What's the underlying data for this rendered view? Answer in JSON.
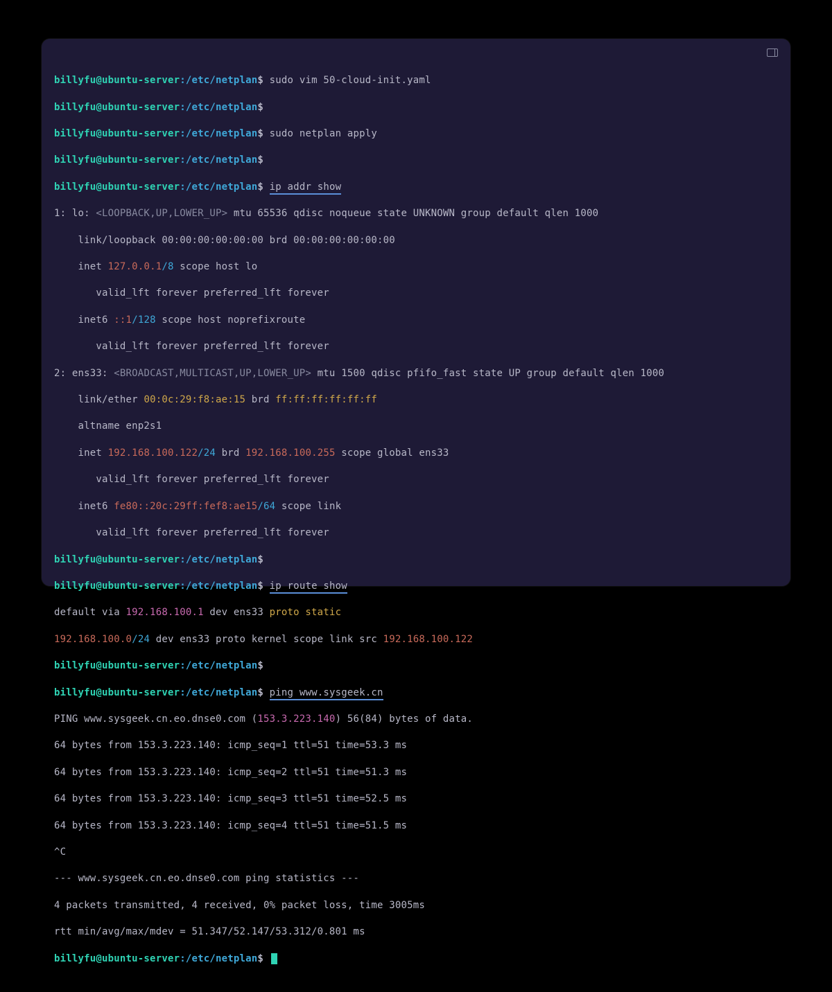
{
  "prompt": {
    "user": "billyfu@ubuntu-server",
    "sep": ":",
    "path": "/etc/netplan",
    "dollar": "$"
  },
  "commands": {
    "vim": "sudo vim 50-cloud-init.yaml",
    "apply": "sudo netplan apply",
    "ipaddr": "ip addr show",
    "iproute": "ip route show",
    "ping": "ping www.sysgeek.cn"
  },
  "ipaddr_out": {
    "l1a": "1: lo: ",
    "l1b": "<LOOPBACK,UP,LOWER_UP>",
    "l1c": " mtu 65536 qdisc noqueue state UNKNOWN group default qlen 1000",
    "l2": "    link/loopback 00:00:00:00:00:00 brd 00:00:00:00:00:00",
    "l3a": "    inet ",
    "l3b": "127.0.0.1",
    "l3c": "/8",
    "l3d": " scope host lo",
    "l4": "       valid_lft forever preferred_lft forever",
    "l5a": "    inet6 ",
    "l5b": "::1",
    "l5c": "/128",
    "l5d": " scope host noprefixroute",
    "l6": "       valid_lft forever preferred_lft forever",
    "l7a": "2: ens33: ",
    "l7b": "<BROADCAST,MULTICAST,UP,LOWER_UP>",
    "l7c": " mtu 1500 qdisc pfifo_fast state UP group default qlen 1000",
    "l8a": "    link/ether ",
    "l8b": "00:0c:29:f8:ae:15",
    "l8c": " brd ",
    "l8d": "ff:ff:ff:ff:ff:ff",
    "l9": "    altname enp2s1",
    "l10a": "    inet ",
    "l10b": "192.168.100.122",
    "l10c": "/24",
    "l10d": " brd ",
    "l10e": "192.168.100.255",
    "l10f": " scope global ens33",
    "l11": "       valid_lft forever preferred_lft forever",
    "l12a": "    inet6 ",
    "l12b": "fe80::20c:29ff:fef8:ae15",
    "l12c": "/64",
    "l12d": " scope link",
    "l13": "       valid_lft forever preferred_lft forever"
  },
  "iproute_out": {
    "l1a": "default via ",
    "l1b": "192.168.100.1",
    "l1c": " dev ens33 ",
    "l1d": "proto static",
    "l2a": "192.168.100.0",
    "l2b": "/24",
    "l2c": " dev ens33 proto kernel scope link src ",
    "l2d": "192.168.100.122"
  },
  "ping_out": {
    "l1a": "PING www.sysgeek.cn.eo.dnse0.com (",
    "l1b": "153.3.223.140",
    "l1c": ") 56(84) bytes of data.",
    "l2": "64 bytes from 153.3.223.140: icmp_seq=1 ttl=51 time=53.3 ms",
    "l3": "64 bytes from 153.3.223.140: icmp_seq=2 ttl=51 time=51.3 ms",
    "l4": "64 bytes from 153.3.223.140: icmp_seq=3 ttl=51 time=52.5 ms",
    "l5": "64 bytes from 153.3.223.140: icmp_seq=4 ttl=51 time=51.5 ms",
    "l6": "^C",
    "l7": "--- www.sysgeek.cn.eo.dnse0.com ping statistics ---",
    "l8": "4 packets transmitted, 4 received, 0% packet loss, time 3005ms",
    "l9": "rtt min/avg/max/mdev = 51.347/52.147/53.312/0.801 ms"
  }
}
